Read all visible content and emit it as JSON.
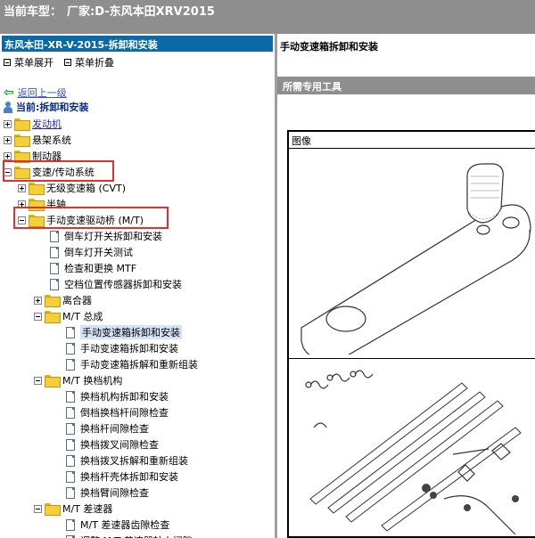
{
  "topbar": {
    "label": "当前车型：",
    "model": "厂家:D-东风本田XRV2015"
  },
  "left": {
    "header": "东风本田-XR-V-2015-拆卸和安装",
    "menu": [
      {
        "label": "菜单展开"
      },
      {
        "label": "菜单折叠"
      }
    ],
    "back_label": "返回上一级",
    "current_label": "当前:拆卸和安装",
    "tree": [
      {
        "label": "发动机",
        "toggle": "plus",
        "link": true
      },
      {
        "label": "悬架系统",
        "toggle": "plus",
        "link": false
      },
      {
        "label": "制动器",
        "toggle": "plus",
        "link": false
      },
      {
        "label": "变速/传动系统",
        "toggle": "minus",
        "link": false
      },
      {
        "label": "无级变速箱 (CVT)",
        "toggle": "plus",
        "link": false
      },
      {
        "label": "半轴",
        "toggle": "plus",
        "link": false
      },
      {
        "label": "手动变速驱动桥 (M/T)",
        "toggle": "minus",
        "link": false
      },
      {
        "label": "倒车灯开关拆卸和安装",
        "type": "doc"
      },
      {
        "label": "倒车灯开关测试",
        "type": "doc"
      },
      {
        "label": "检查和更换 MTF",
        "type": "doc"
      },
      {
        "label": "空档位置传感器拆卸和安装",
        "type": "doc"
      },
      {
        "label": "离合器",
        "toggle": "plus",
        "link": false
      },
      {
        "label": "M/T 总成",
        "toggle": "minus",
        "link": false
      },
      {
        "label": "手动变速箱拆卸和安装",
        "type": "doc",
        "selected": true
      },
      {
        "label": "手动变速箱拆卸和安装",
        "type": "doc"
      },
      {
        "label": "手动变速箱拆解和重新组装",
        "type": "doc"
      },
      {
        "label": "M/T 换档机构",
        "toggle": "minus",
        "link": false
      },
      {
        "label": "换档机构拆卸和安装",
        "type": "doc"
      },
      {
        "label": "倒档换档杆间隙检查",
        "type": "doc"
      },
      {
        "label": "换档杆间隙检查",
        "type": "doc"
      },
      {
        "label": "换档拨叉间隙检查",
        "type": "doc"
      },
      {
        "label": "换档拨叉拆解和重新组装",
        "type": "doc"
      },
      {
        "label": "换档杆壳体拆卸和安装",
        "type": "doc"
      },
      {
        "label": "换档臂间隙检查",
        "type": "doc"
      },
      {
        "label": "M/T 差速器",
        "toggle": "minus",
        "link": false
      },
      {
        "label": "M/T 差速器齿隙检查",
        "type": "doc"
      },
      {
        "label": "调整 M/T 差速器轴上间隙",
        "type": "doc"
      }
    ]
  },
  "right": {
    "title": "手动变速箱拆卸和安装",
    "section": "所需专用工具",
    "image_caption": "图像"
  },
  "colors": {
    "header_blue": "#0b6aa6",
    "banner_gray": "#8e8e8e",
    "highlight_red": "#e03030"
  }
}
